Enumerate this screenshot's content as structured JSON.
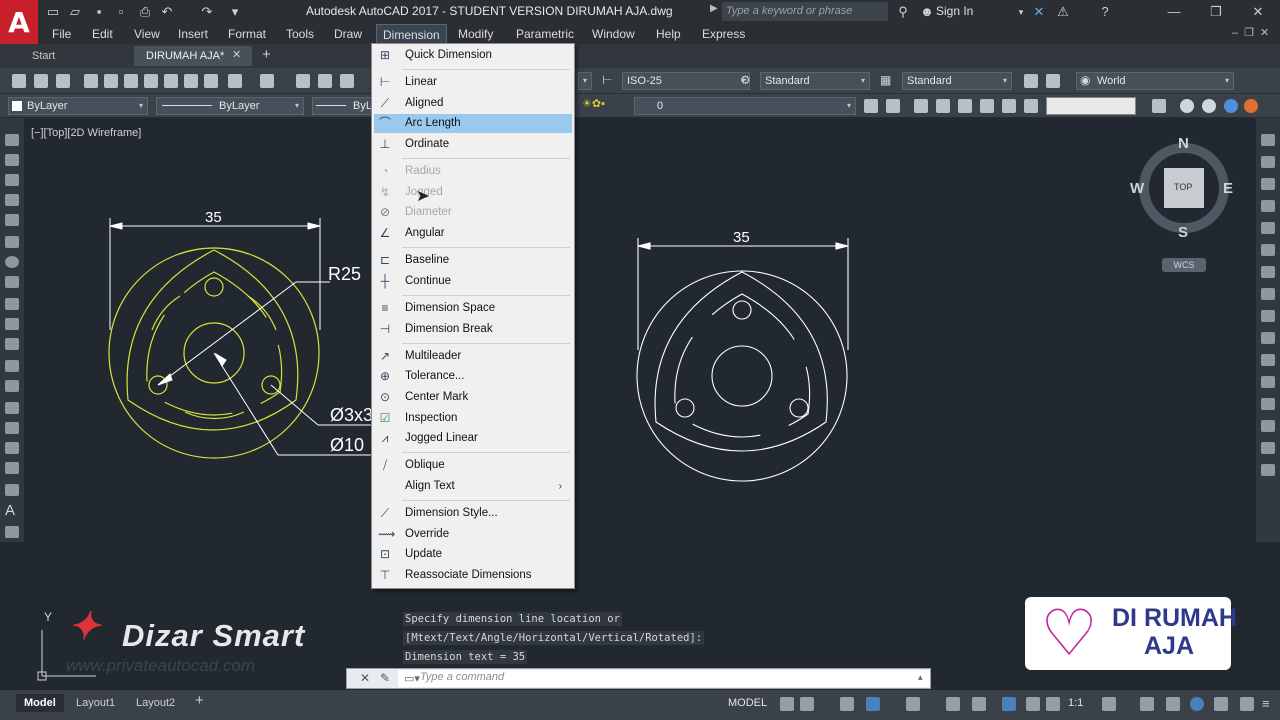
{
  "window": {
    "title": "Autodesk AutoCAD 2017 - STUDENT VERSION    DIRUMAH AJA.dwg",
    "search_placeholder": "Type a keyword or phrase",
    "sign_in": "Sign In"
  },
  "menubar": [
    "File",
    "Edit",
    "View",
    "Insert",
    "Format",
    "Tools",
    "Draw",
    "Dimension",
    "Modify",
    "Parametric",
    "Window",
    "Help",
    "Express"
  ],
  "file_tabs": [
    "Start",
    "DIRUMAH AJA*"
  ],
  "toolbar": {
    "dimstyle": "ISO-25",
    "textstyle": "Standard",
    "tablestyle": "Standard",
    "ucs": "World",
    "color": "ByLayer",
    "linetype": "ByLayer",
    "lineweight": "ByLa",
    "layer": "0"
  },
  "viewport_label": "[−][Top][2D Wireframe]",
  "viewcube": {
    "n": "N",
    "s": "S",
    "e": "E",
    "w": "W",
    "top": "TOP",
    "wcs": "WCS"
  },
  "dimension_menu": [
    {
      "label": "Quick Dimension",
      "icon": "quick-dimension-icon",
      "state": "normal"
    },
    {
      "label": "Linear",
      "icon": "linear-icon",
      "state": "normal"
    },
    {
      "label": "Aligned",
      "icon": "aligned-icon",
      "state": "normal"
    },
    {
      "label": "Arc Length",
      "icon": "arc-length-icon",
      "state": "highlighted"
    },
    {
      "label": "Ordinate",
      "icon": "ordinate-icon",
      "state": "normal"
    },
    {
      "label": "Radius",
      "icon": "radius-icon",
      "state": "disabled"
    },
    {
      "label": "Jogged",
      "icon": "jogged-icon",
      "state": "disabled"
    },
    {
      "label": "Diameter",
      "icon": "diameter-icon",
      "state": "disabled"
    },
    {
      "label": "Angular",
      "icon": "angular-icon",
      "state": "normal"
    },
    {
      "label": "Baseline",
      "icon": "baseline-icon",
      "state": "normal"
    },
    {
      "label": "Continue",
      "icon": "continue-icon",
      "state": "normal"
    },
    {
      "label": "Dimension Space",
      "icon": "dimension-space-icon",
      "state": "normal"
    },
    {
      "label": "Dimension Break",
      "icon": "dimension-break-icon",
      "state": "normal"
    },
    {
      "label": "Multileader",
      "icon": "multileader-icon",
      "state": "normal"
    },
    {
      "label": "Tolerance...",
      "icon": "tolerance-icon",
      "state": "normal"
    },
    {
      "label": "Center Mark",
      "icon": "center-mark-icon",
      "state": "normal"
    },
    {
      "label": "Inspection",
      "icon": "inspection-icon",
      "state": "normal"
    },
    {
      "label": "Jogged Linear",
      "icon": "jogged-linear-icon",
      "state": "normal"
    },
    {
      "label": "Oblique",
      "icon": "oblique-icon",
      "state": "normal"
    },
    {
      "label": "Align Text",
      "icon": "align-text-icon",
      "state": "normal",
      "submenu": true
    },
    {
      "label": "Dimension Style...",
      "icon": "dimension-style-icon",
      "state": "normal"
    },
    {
      "label": "Override",
      "icon": "override-icon",
      "state": "normal"
    },
    {
      "label": "Update",
      "icon": "update-icon",
      "state": "normal"
    },
    {
      "label": "Reassociate Dimensions",
      "icon": "reassociate-icon",
      "state": "normal"
    }
  ],
  "drawing_left": {
    "dim_top": "35",
    "radius": "R25",
    "hole": "Ø3x3",
    "center": "Ø10"
  },
  "drawing_right": {
    "dim_top": "35"
  },
  "command": {
    "history": [
      "Specify dimension line location or",
      "[Mtext/Text/Angle/Horizontal/Vertical/Rotated]:",
      "Dimension text = 35"
    ],
    "placeholder": "Type a command"
  },
  "layout_tabs": [
    "Model",
    "Layout1",
    "Layout2"
  ],
  "status": {
    "model": "MODEL",
    "scale": "1:1"
  },
  "watermarks": {
    "brand": "Dizar Smart",
    "brand_sub": "www.privateautocad.com",
    "logo_line1": "DI RUMAH",
    "logo_line2": "AJA"
  },
  "colors": {
    "highlight": "#99c9ef",
    "drawing_yellow": "#d8e23a",
    "drawing_white": "#ffffff",
    "canvas": "#212830"
  }
}
